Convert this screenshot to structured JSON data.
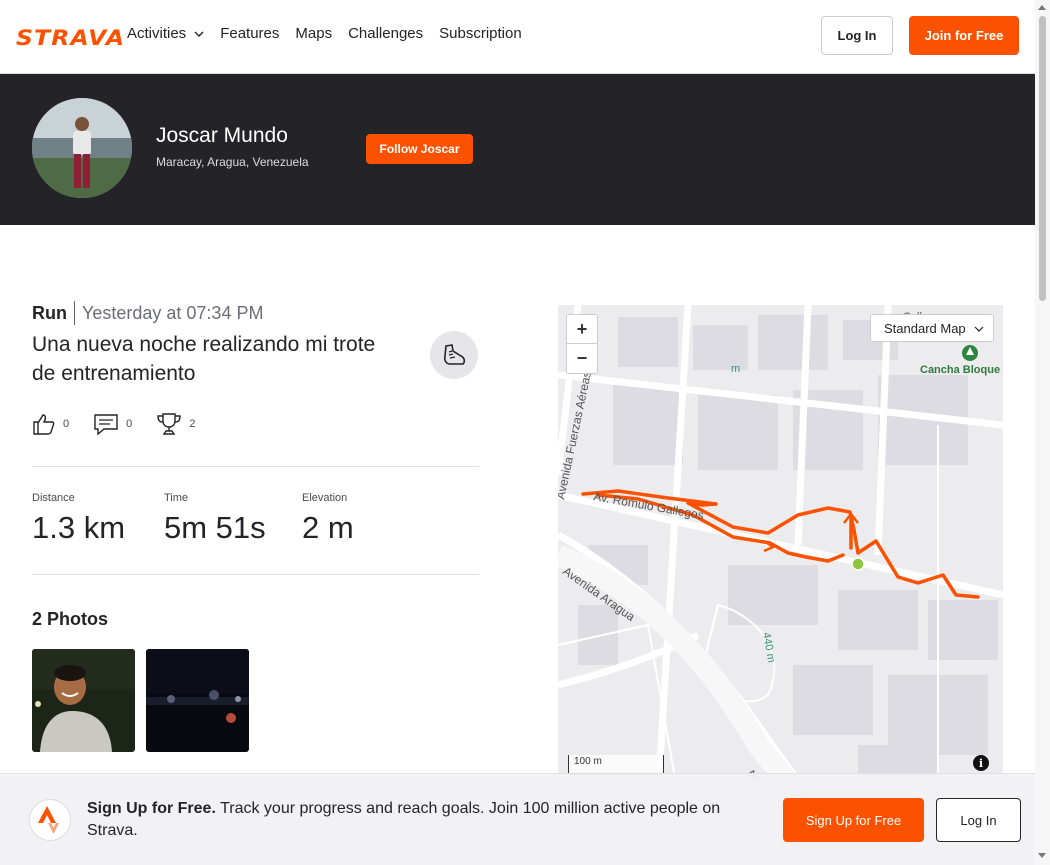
{
  "brand": {
    "logo_text": "STRAVA",
    "accent": "#fc5200"
  },
  "nav": {
    "items": [
      "Activities",
      "Features",
      "Maps",
      "Challenges",
      "Subscription"
    ],
    "login_label": "Log In",
    "join_label": "Join for Free"
  },
  "athlete": {
    "name": "Joscar Mundo",
    "location": "Maracay, Aragua, Venezuela",
    "follow_label": "Follow Joscar"
  },
  "activity": {
    "type": "Run",
    "time": "Yesterday at 07:34 PM",
    "title": "Una nueva noche realizando mi trote de entrenamiento",
    "kudos_count": "0",
    "comments_count": "0",
    "achievements_count": "2",
    "stats": [
      {
        "label": "Distance",
        "value": "1.3 km"
      },
      {
        "label": "Time",
        "value": "5m 51s"
      },
      {
        "label": "Elevation",
        "value": "2 m"
      }
    ],
    "photos_heading": "2 Photos"
  },
  "map": {
    "type_label": "Standard Map",
    "zoom_in": "+",
    "zoom_out": "−",
    "scale_label": "100 m",
    "info_label": "i",
    "labels": {
      "street1": "Av. Romulo Gallegos",
      "street2": "Avenida Aragua",
      "street3": "Avenida Fuerzas Aéreas",
      "contour": "440 m",
      "contour2": "m",
      "poi": "Cancha Bloque",
      "top": "Call",
      "bottom": "Av"
    }
  },
  "signup": {
    "lead": "Sign Up for Free.",
    "text": " Track your progress and reach goals. Join 100 million active people on Strava.",
    "signup_label": "Sign Up for Free",
    "login_label": "Log In"
  }
}
